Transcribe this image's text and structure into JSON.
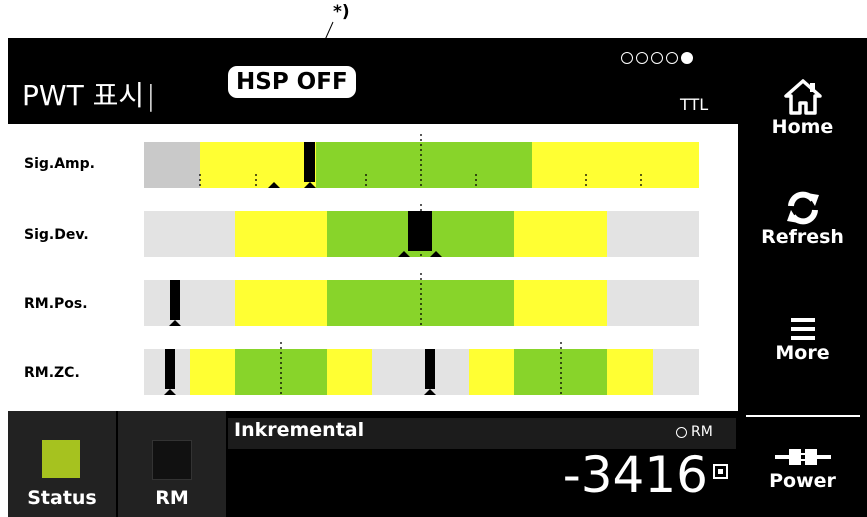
{
  "annotation": "*)",
  "header": {
    "title": "PWT 표시",
    "hsp_badge": "HSP OFF",
    "mode": "TTL",
    "page_dots": {
      "total": 5,
      "active": 5
    }
  },
  "sidebar": {
    "home": "Home",
    "refresh": "Refresh",
    "more": "More",
    "power": "Power"
  },
  "rows": [
    {
      "label": "Sig.Amp."
    },
    {
      "label": "Sig.Dev."
    },
    {
      "label": "RM.Pos."
    },
    {
      "label": "RM.ZC."
    }
  ],
  "colors": {
    "gray": "#e3e3e3",
    "dark_gray": "#c9c9c9",
    "yellow": "#ffff33",
    "green": "#88d42a",
    "status_green": "#a6c21f"
  },
  "bottom": {
    "status_label": "Status",
    "rm_label": "RM",
    "inkremental_label": "Inkremental",
    "rm_indicator": "RM",
    "value": "-3416"
  }
}
